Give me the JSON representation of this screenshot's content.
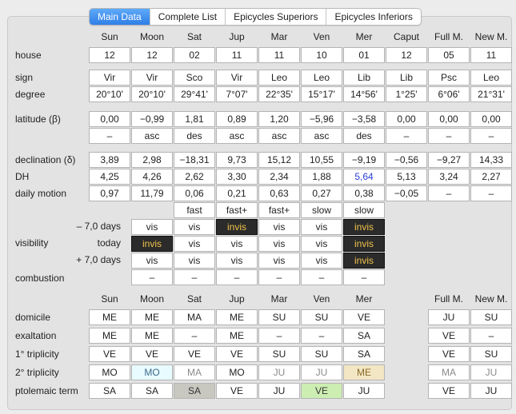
{
  "tabs": [
    "Main Data",
    "Complete List",
    "Epicycles Superiors",
    "Epicycles Inferiors"
  ],
  "active_tab": 0,
  "planets": [
    "Sun",
    "Moon",
    "Sat",
    "Jup",
    "Mar",
    "Ven",
    "Mer",
    "Caput",
    "Full M.",
    "New M."
  ],
  "rows": {
    "house_label": "house",
    "house": [
      "12",
      "12",
      "02",
      "11",
      "11",
      "10",
      "01",
      "12",
      "05",
      "11"
    ],
    "sign_label": "sign",
    "sign": [
      "Vir",
      "Vir",
      "Sco",
      "Vir",
      "Leo",
      "Leo",
      "Lib",
      "Lib",
      "Psc",
      "Leo"
    ],
    "degree_label": "degree",
    "degree": [
      "20°10'",
      "20°10'",
      "29°41'",
      "7°07'",
      "22°35'",
      "15°17'",
      "14°56'",
      "1°25'",
      "6°06'",
      "21°31'"
    ],
    "latitude_label": "latitude (β)",
    "latitude": [
      "0,00",
      "−0,99",
      "1,81",
      "0,89",
      "1,20",
      "−5,96",
      "−3,58",
      "0,00",
      "0,00",
      "0,00"
    ],
    "latdir": [
      "–",
      "asc",
      "des",
      "asc",
      "asc",
      "asc",
      "des",
      "–",
      "–",
      "–"
    ],
    "declination_label": "declination (δ)",
    "declination": [
      "3,89",
      "2,98",
      "−18,31",
      "9,73",
      "15,12",
      "10,55",
      "−9,19",
      "−0,56",
      "−9,27",
      "14,33"
    ],
    "dh_label": "DH",
    "dh": [
      "4,25",
      "4,26",
      "2,62",
      "3,30",
      "2,34",
      "1,88",
      "5,64",
      "5,13",
      "3,24",
      "2,27"
    ],
    "daily_label": "daily motion",
    "daily": [
      "0,97",
      "11,79",
      "0,06",
      "0,21",
      "0,63",
      "0,27",
      "0,38",
      "−0,05",
      "–",
      "–"
    ],
    "speed": [
      "fast",
      "fast+",
      "fast+",
      "slow",
      "slow"
    ]
  },
  "visibility": {
    "label": "visibility",
    "minus_label": "– 7,0 days",
    "today_label": "today",
    "plus_label": "+ 7,0 days",
    "minus": [
      "vis",
      "vis",
      "invis",
      "vis",
      "vis",
      "invis"
    ],
    "today": [
      "invis",
      "vis",
      "vis",
      "vis",
      "vis",
      "invis"
    ],
    "plus": [
      "vis",
      "vis",
      "vis",
      "vis",
      "vis",
      "invis"
    ]
  },
  "combustion_label": "combustion",
  "combustion": [
    "–",
    "–",
    "–",
    "–",
    "–",
    "–"
  ],
  "dignity_planets": [
    "Sun",
    "Moon",
    "Sat",
    "Jup",
    "Mar",
    "Ven",
    "Mer",
    "Full M.",
    "New M."
  ],
  "dignities": {
    "domicile_label": "domicile",
    "domicile": [
      "ME",
      "ME",
      "MA",
      "ME",
      "SU",
      "SU",
      "VE",
      "JU",
      "SU"
    ],
    "exaltation_label": "exaltation",
    "exaltation": [
      "ME",
      "ME",
      "–",
      "ME",
      "–",
      "–",
      "SA",
      "VE",
      "–"
    ],
    "trip1_label": "1° triplicity",
    "trip1": [
      "VE",
      "VE",
      "VE",
      "VE",
      "SU",
      "SU",
      "SA",
      "VE",
      "SU"
    ],
    "trip2_label": "2° triplicity",
    "trip2": [
      "MO",
      "MO",
      "MA",
      "MO",
      "JU",
      "JU",
      "ME",
      "MA",
      "JU"
    ],
    "term_label": "ptolemaic term",
    "term": [
      "SA",
      "SA",
      "SA",
      "VE",
      "JU",
      "VE",
      "JU",
      "VE",
      "JU"
    ]
  },
  "colors": {
    "accent": "#2f7fe6",
    "invis_bg": "#2b2b2b",
    "invis_fg": "#f0c24a",
    "dh_highlight": "#2a3fd6"
  }
}
